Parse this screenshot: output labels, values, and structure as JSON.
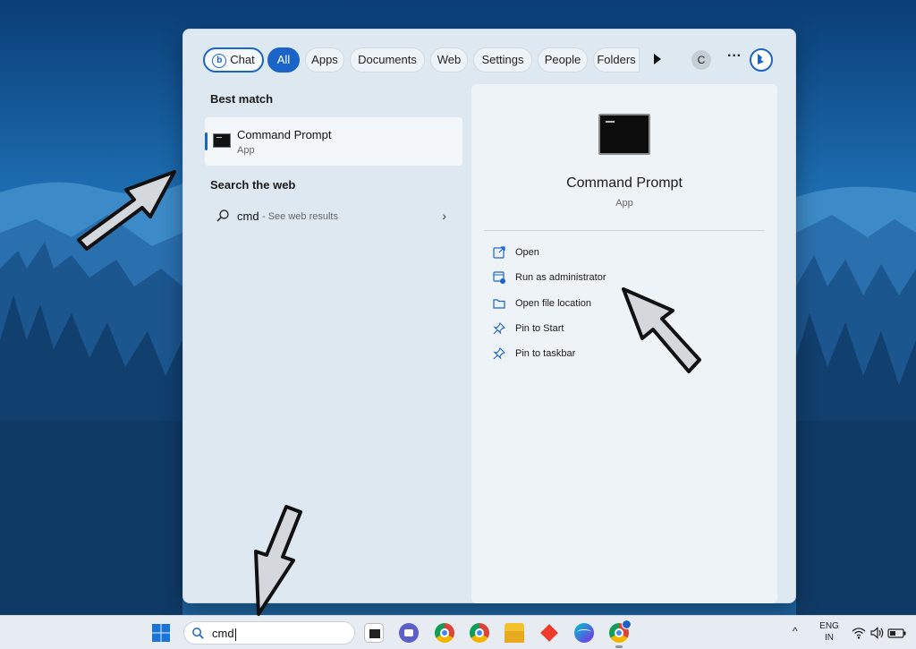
{
  "filter_bar": {
    "chips": [
      {
        "label": "Chat",
        "active": false
      },
      {
        "label": "All",
        "active": true
      },
      {
        "label": "Apps",
        "active": false
      },
      {
        "label": "Documents",
        "active": false
      },
      {
        "label": "Web",
        "active": false
      },
      {
        "label": "Settings",
        "active": false
      },
      {
        "label": "People",
        "active": false
      },
      {
        "label": "Folders",
        "active": false
      }
    ],
    "account_initial": "C",
    "more_options": "···"
  },
  "best_match": {
    "title": "Best match",
    "name": "Command Prompt",
    "type": "App"
  },
  "web_search": {
    "title": "Search the web",
    "query": "cmd",
    "hint": "- See web results",
    "chevron": "›"
  },
  "detail": {
    "title": "Command Prompt",
    "subtitle": "App",
    "actions": [
      {
        "label": "Open",
        "icon": "open-external-icon"
      },
      {
        "label": "Run as administrator",
        "icon": "shield-window-icon"
      },
      {
        "label": "Open file location",
        "icon": "folder-icon"
      },
      {
        "label": "Pin to Start",
        "icon": "pin-icon"
      },
      {
        "label": "Pin to taskbar",
        "icon": "pin-icon"
      }
    ]
  },
  "taskbar": {
    "search_text": "cmd",
    "tray_chevron": "^",
    "lang_line1": "ENG",
    "lang_line2": "IN",
    "apps": [
      "cmd-icon",
      "teams-icon",
      "chrome-icon",
      "chrome-icon",
      "file-explorer-icon",
      "anydesk-icon",
      "canva-icon",
      "chrome-profile-icon"
    ]
  },
  "colors": {
    "accent": "#1a64c8",
    "panel_bg": "#dde8f1",
    "detail_bg": "#eef3f8",
    "taskbar_bg": "#e6ecf2"
  }
}
